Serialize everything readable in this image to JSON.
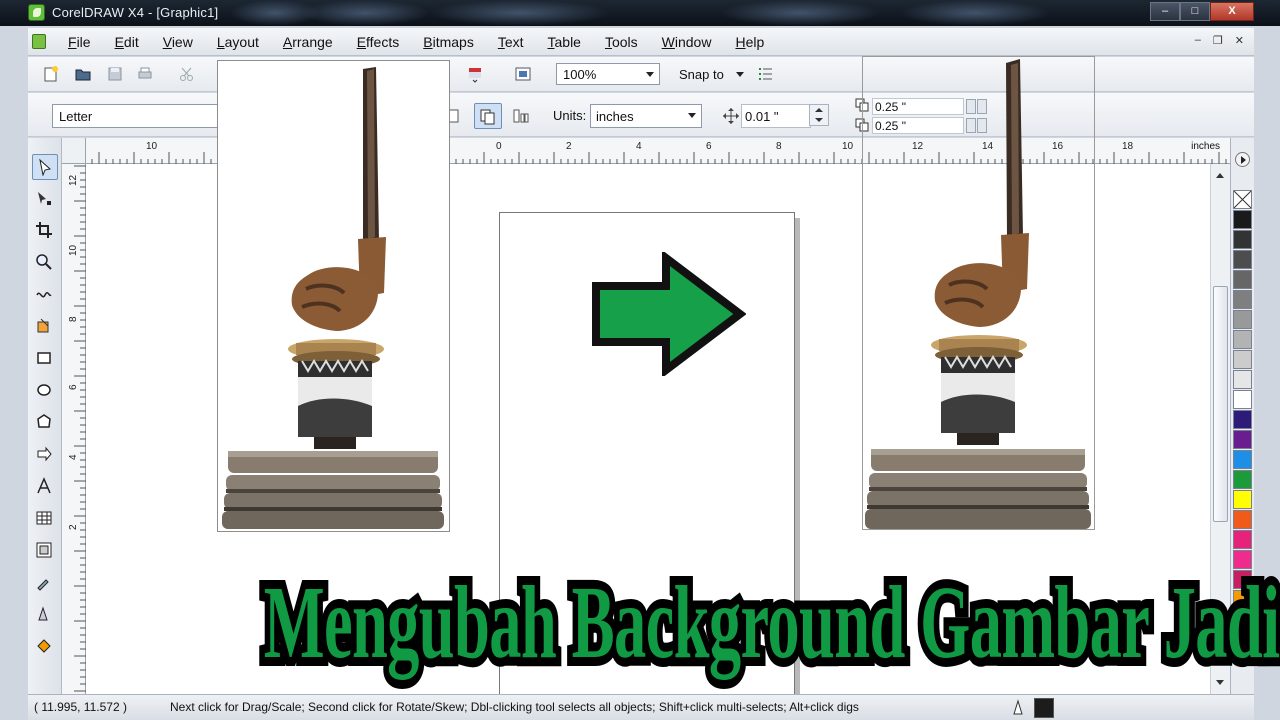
{
  "window": {
    "title": "CorelDRAW X4 - [Graphic1]",
    "buttons": {
      "minimize": "–",
      "maximize": "□",
      "close": "X"
    }
  },
  "menu": {
    "items": [
      {
        "label": "File"
      },
      {
        "label": "Edit"
      },
      {
        "label": "View"
      },
      {
        "label": "Layout"
      },
      {
        "label": "Arrange"
      },
      {
        "label": "Effects"
      },
      {
        "label": "Bitmaps"
      },
      {
        "label": "Text"
      },
      {
        "label": "Table"
      },
      {
        "label": "Tools"
      },
      {
        "label": "Window"
      },
      {
        "label": "Help"
      }
    ],
    "doc_controls": {
      "minimize": "–",
      "restore": "❐",
      "close": "✕"
    }
  },
  "standard_toolbar": {
    "zoom": "100%",
    "snap_to": "Snap to"
  },
  "property_bar": {
    "paper_size": "Letter",
    "units_label": "Units:",
    "units_value": "inches",
    "nudge": "0.01 \"",
    "duplicate_x": "0.25 \"",
    "duplicate_y": "0.25 \""
  },
  "ruler": {
    "h_labels": [
      "10",
      "0",
      "2",
      "4",
      "6",
      "8",
      "10",
      "12",
      "14",
      "16",
      "18"
    ],
    "unit": "inches",
    "v_labels": [
      "12",
      "10",
      "8",
      "6",
      "4",
      "2"
    ]
  },
  "palette": {
    "colors": [
      "#ffffff",
      "#1a1a1a",
      "#333333",
      "#4d4d4d",
      "#666666",
      "#7f7f7f",
      "#999999",
      "#b3b3b3",
      "#cccccc",
      "#e6e6e6",
      "#ffffff",
      "#2e1a78",
      "#6a1d8f",
      "#1e8fe6",
      "#1d9b3a",
      "#ffff00",
      "#f05a1a",
      "#e6227a",
      "#ef2b8c",
      "#c81e63",
      "#f29a00",
      "#f4b4c0"
    ]
  },
  "status": {
    "coords": "( 11.995, 11.572 )",
    "hint": "Next click for Drag/Scale; Second click for Rotate/Skew; Dbl-clicking tool selects all objects; Shift+click multi-selects; Alt+click digs"
  },
  "caption": {
    "text": "Mengubah Background Gambar Jadi Transparan"
  },
  "colors": {
    "arrow_fill": "#16a04a",
    "caption_fill": "#119a44"
  }
}
